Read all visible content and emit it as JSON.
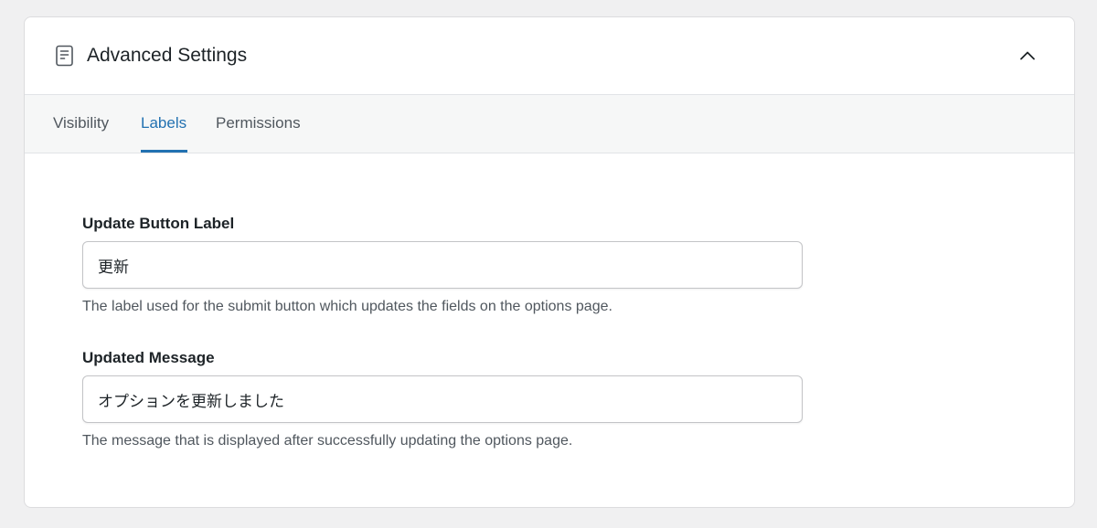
{
  "panel": {
    "title": "Advanced Settings",
    "icon": "document-icon",
    "toggle_icon": "chevron-up-icon"
  },
  "tabs": [
    {
      "label": "Visibility",
      "active": false
    },
    {
      "label": "Labels",
      "active": true
    },
    {
      "label": "Permissions",
      "active": false
    }
  ],
  "fields": [
    {
      "label": "Update Button Label",
      "value": "更新",
      "help": "The label used for the submit button which updates the fields on the options page."
    },
    {
      "label": "Updated Message",
      "value": "オプションを更新しました",
      "help": "The message that is displayed after successfully updating the options page."
    }
  ],
  "colors": {
    "accent": "#2271b1",
    "text": "#1d2327",
    "muted": "#50575e",
    "border": "#c3c4c7",
    "background": "#f0f0f1"
  }
}
